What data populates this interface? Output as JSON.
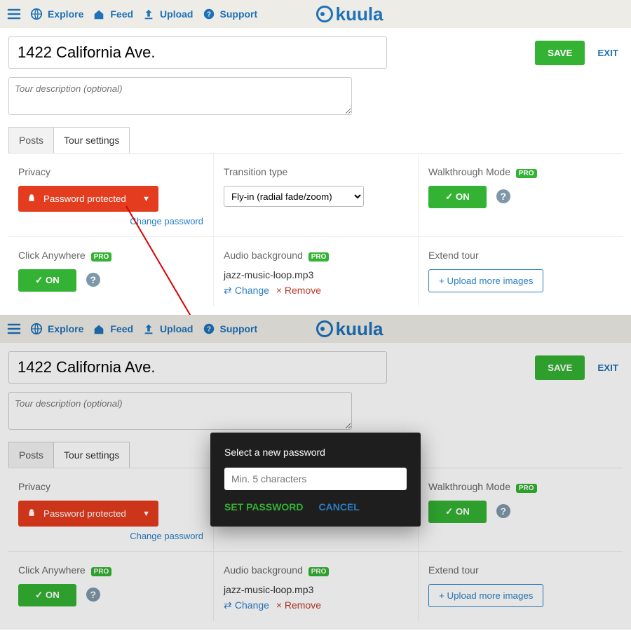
{
  "nav": {
    "explore": "Explore",
    "feed": "Feed",
    "upload": "Upload",
    "support": "Support",
    "brand": "kuula"
  },
  "topbar_right": {
    "save": "SAVE",
    "exit": "EXIT"
  },
  "title": "1422 California Ave.",
  "desc_placeholder": "Tour description (optional)",
  "tabs": {
    "posts": "Posts",
    "settings": "Tour settings"
  },
  "privacy": {
    "label": "Privacy",
    "value": "Password protected",
    "caret": "▼",
    "change": "Change password"
  },
  "transition": {
    "label": "Transition type",
    "value": "Fly-in (radial fade/zoom)"
  },
  "walkthrough": {
    "label": "Walkthrough Mode",
    "badge": "PRO",
    "on": "✓ ON"
  },
  "clickany": {
    "label": "Click Anywhere",
    "badge": "PRO",
    "on": "✓ ON"
  },
  "audio": {
    "label": "Audio background",
    "badge": "PRO",
    "file": "jazz-music-loop.mp3",
    "change": "Change",
    "remove": "× Remove"
  },
  "extend": {
    "label": "Extend tour",
    "btn": "+ Upload more images"
  },
  "modal": {
    "title": "Select a new password",
    "placeholder": "Min. 5 characters",
    "set": "SET PASSWORD",
    "cancel": "CANCEL"
  }
}
